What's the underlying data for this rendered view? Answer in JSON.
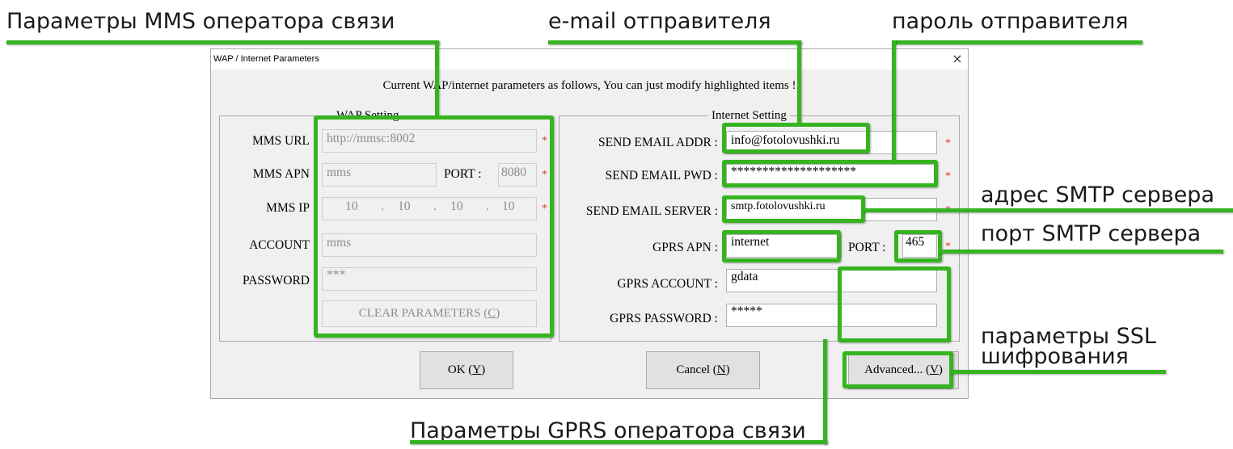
{
  "annotations": {
    "mms_params": "Параметры MMS оператора связи",
    "email_sender": "e-mail отправителя",
    "password_sender": "пароль отправителя",
    "smtp_address": "адрес SMTP сервера",
    "smtp_port": "порт SMTP сервера",
    "ssl_line1": "параметры SSL",
    "ssl_line2": "шифрования",
    "gprs_params": "Параметры GPRS оператора связи"
  },
  "dialog": {
    "title": "WAP / Internet Parameters",
    "close": "×",
    "intro": "Current WAP/internet parameters as follows, You can just modify highlighted items !"
  },
  "wap": {
    "group_title": "WAP Setting",
    "mms_url_label": "MMS URL",
    "mms_url": "http://mmsc:8002",
    "mms_apn_label": "MMS APN",
    "mms_apn": "mms",
    "port_label": "PORT :",
    "port": "8080",
    "mms_ip_label": "MMS IP",
    "ip": [
      "10",
      "10",
      "10",
      "10"
    ],
    "ip_dot": ".",
    "account_label": "ACCOUNT",
    "account": "mms",
    "password_label": "PASSWORD",
    "password": "***",
    "clear_label": "CLEAR PARAMETERS (",
    "clear_key": "C",
    "clear_end": ")"
  },
  "internet": {
    "group_title": "Internet Setting",
    "send_email_addr_label": "SEND EMAIL ADDR :",
    "send_email_addr": "info@fotolovushki.ru",
    "send_email_pwd_label": "SEND EMAIL PWD :",
    "send_email_pwd": "********************",
    "send_email_server_label": "SEND EMAIL SERVER :",
    "send_email_server": "smtp.fotolovushki.ru",
    "gprs_apn_label": "GPRS APN :",
    "gprs_apn": "internet",
    "port_label": "PORT :",
    "port": "465",
    "gprs_account_label": "GPRS ACCOUNT :",
    "gprs_account": "gdata",
    "gprs_password_label": "GPRS PASSWORD :",
    "gprs_password": "*****"
  },
  "required_marker": "*",
  "buttons": {
    "ok": "OK (",
    "ok_key": "Y",
    "cancel": "Cancel (",
    "cancel_key": "N",
    "advanced": "Advanced... (",
    "advanced_key": "V",
    "close_paren": ")"
  },
  "colors": {
    "highlight_green": "#36b41f",
    "required_star": "#e0392b"
  }
}
